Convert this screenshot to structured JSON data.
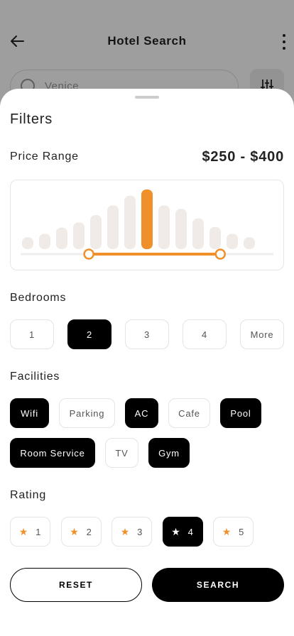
{
  "background": {
    "title": "Hotel Search",
    "search_placeholder": "Venice",
    "back_icon": "arrow-left-icon",
    "more_icon": "more-vertical-icon",
    "filter_icon": "sliders-icon"
  },
  "filters": {
    "title": "Filters",
    "price": {
      "label": "Price Range",
      "value": "$250 - $400",
      "selected_range_fraction": [
        0.27,
        0.79
      ],
      "histogram_levels": [
        0.16,
        0.22,
        0.33,
        0.42,
        0.55,
        0.72,
        0.89,
        1.0,
        0.72,
        0.66,
        0.49,
        0.34,
        0.22,
        0.16
      ],
      "highlight_index": 7,
      "accent_color": "#f0902a",
      "bar_color": "#f1ebe7"
    },
    "bedrooms": {
      "label": "Bedrooms",
      "options": [
        "1",
        "2",
        "3",
        "4",
        "More"
      ],
      "selected": "2"
    },
    "facilities": {
      "label": "Facilities",
      "row1": [
        {
          "label": "Wifi",
          "active": true
        },
        {
          "label": "Parking",
          "active": false
        },
        {
          "label": "AC",
          "active": true
        },
        {
          "label": "Cafe",
          "active": false
        },
        {
          "label": "Pool",
          "active": true
        }
      ],
      "row2": [
        {
          "label": "Room Service",
          "active": true
        },
        {
          "label": "TV",
          "active": false
        },
        {
          "label": "Gym",
          "active": true
        }
      ]
    },
    "rating": {
      "label": "Rating",
      "options": [
        "1",
        "2",
        "3",
        "4",
        "5"
      ],
      "selected": "4",
      "icon": "star-icon"
    },
    "reset_label": "RESET",
    "search_label": "SEARCH"
  }
}
